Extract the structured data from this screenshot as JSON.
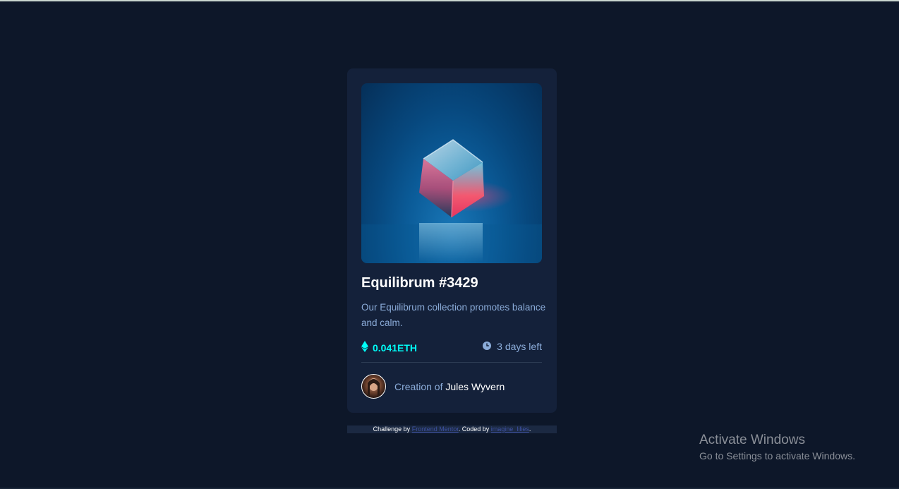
{
  "card": {
    "title": "Equilibrum #3429",
    "description": "Our Equilibrum collection promotes balance and calm.",
    "price": "0.041ETH",
    "time_left": "3 days left",
    "creator_prefix": "Creation of",
    "creator_name": "Jules Wyvern",
    "icons": [
      "ethereum-icon",
      "clock-icon"
    ]
  },
  "attribution": {
    "prefix": "Challenge by",
    "challenge_link": "Frontend Mentor",
    "coded_by": ". Coded by",
    "author_link": "imagine_lilies",
    "suffix": "."
  },
  "watermark": {
    "title": "Activate Windows",
    "subtitle": "Go to Settings to activate Windows."
  },
  "colors": {
    "background": "#0d1729",
    "card": "#14213a",
    "cyan": "#00fff8",
    "soft_blue": "#8bacd9",
    "white": "#ffffff"
  }
}
